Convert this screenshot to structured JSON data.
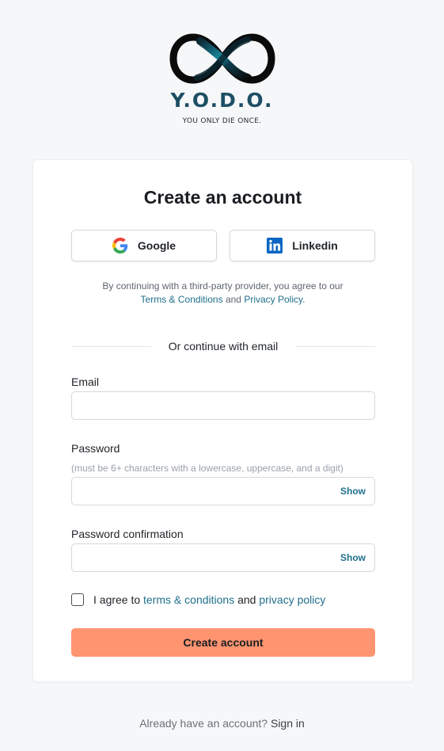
{
  "brand": {
    "name": "Y.O.D.O.",
    "tagline": "YOU ONLY DIE ONCE."
  },
  "card": {
    "title": "Create an account",
    "social": {
      "google_label": "Google",
      "linkedin_label": "Linkedin"
    },
    "disclaimer": {
      "prefix": "By continuing with a third-party provider, you agree to our",
      "terms": "Terms & Conditions",
      "and": "and",
      "privacy": "Privacy Policy",
      "suffix": "."
    },
    "divider_text": "Or continue with email",
    "email": {
      "label": "Email",
      "value": ""
    },
    "password": {
      "label": "Password",
      "hint": "(must be 6+ characters with a lowercase, uppercase, and a digit)",
      "value": "",
      "toggle": "Show"
    },
    "password_confirmation": {
      "label": "Password confirmation",
      "value": "",
      "toggle": "Show"
    },
    "agreement": {
      "prefix": "I agree to",
      "terms": "terms & conditions",
      "and": "and",
      "privacy": "privacy policy",
      "checked": false
    },
    "submit_label": "Create account"
  },
  "footer": {
    "prompt": "Already have an account?",
    "signin": "Sign in"
  },
  "colors": {
    "accent_button": "#ff9470",
    "link": "#1f6f8b",
    "brand_text": "#1d4f63",
    "background": "#f6f7f9"
  }
}
